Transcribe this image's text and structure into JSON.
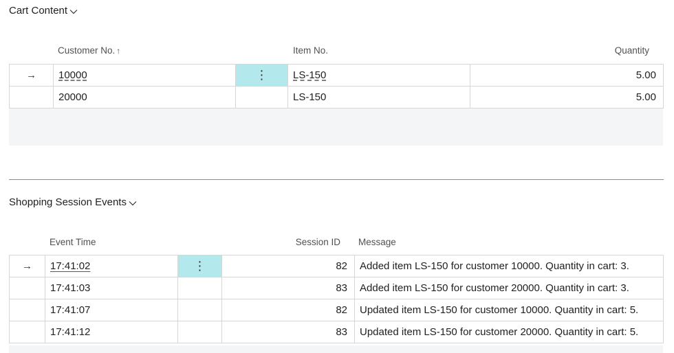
{
  "cart": {
    "title": "Cart Content",
    "columns": {
      "customer_no": "Customer No.",
      "customer_sort_indicator": "↑",
      "item_no": "Item No.",
      "quantity": "Quantity"
    },
    "rows": [
      {
        "customer_no": "10000",
        "item_no": "LS-150",
        "quantity": "5.00",
        "selected": true
      },
      {
        "customer_no": "20000",
        "item_no": "LS-150",
        "quantity": "5.00",
        "selected": false
      }
    ]
  },
  "events": {
    "title": "Shopping Session Events",
    "columns": {
      "event_time": "Event Time",
      "session_id": "Session ID",
      "message": "Message"
    },
    "rows": [
      {
        "event_time": "17:41:02",
        "session_id": "82",
        "message": "Added item LS-150 for customer 10000. Quantity in cart: 3.",
        "selected": true
      },
      {
        "event_time": "17:41:03",
        "session_id": "83",
        "message": "Added item LS-150 for customer 20000. Quantity in cart: 3.",
        "selected": false
      },
      {
        "event_time": "17:41:07",
        "session_id": "82",
        "message": "Updated item LS-150 for customer 10000. Quantity in cart: 5.",
        "selected": false
      },
      {
        "event_time": "17:41:12",
        "session_id": "83",
        "message": "Updated item LS-150 for customer 20000. Quantity in cart: 5.",
        "selected": false
      }
    ]
  },
  "icons": {
    "row_pointer": "→",
    "row_actions": "⋮",
    "collapse": "chevron-down-icon"
  },
  "colors": {
    "active_cell": "#b3e8ec",
    "empty_area": "#f4f5f6",
    "grid_border": "#d6d6d6"
  }
}
